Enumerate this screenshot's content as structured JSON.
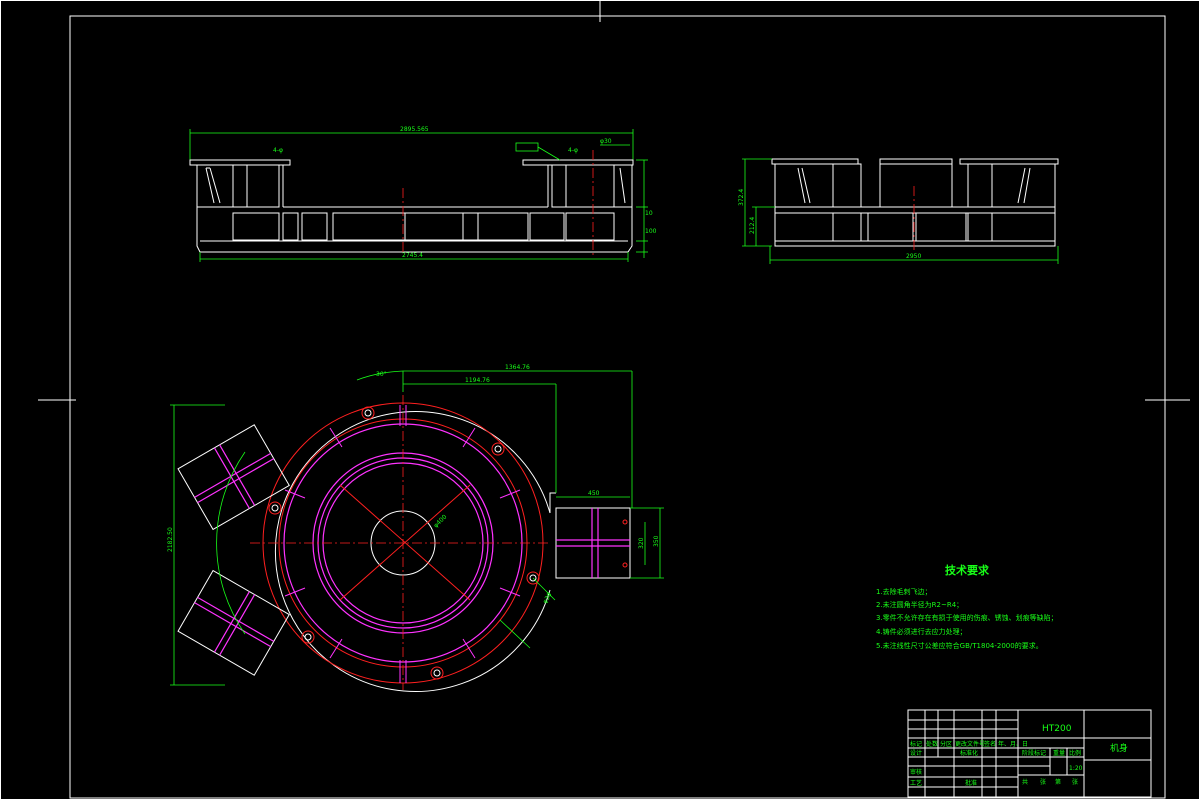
{
  "drawing": {
    "dims": {
      "top_length": "2895.565",
      "base_length": "2745.4",
      "side_width": "2950",
      "dim_a": "40",
      "dim_b": "4-φ",
      "dim_c": "4-φ",
      "dim_d": "40",
      "side_h1": "212.4",
      "side_h2": "372.4",
      "angle": "30°",
      "r1": "1194.76",
      "r2": "1364.76",
      "span": "2182.50",
      "bore": "φ400",
      "arm_len": "450",
      "arm_w": "350",
      "arm_w2": "320",
      "hole": "φ30",
      "v1": "10",
      "v2": "1",
      "v3": "100"
    },
    "tech_title": "技术要求",
    "tech_items": [
      "1.去除毛刺飞边；",
      "2.未注圆角半径为R2~R4；",
      "3.零件不允许存在有损于使用的伤痕、锈蚀、划痕等缺陷；",
      "4.铸件必须进行去应力处理；",
      "5.未注线性尺寸公差应符合GB/T1804-2000的要求。"
    ],
    "title_block": {
      "material": "HT200",
      "part_name": "机身",
      "labels": [
        "标记",
        "处数",
        "分区",
        "更改文件号",
        "签名",
        "年、月、日"
      ],
      "row2": [
        "设计",
        "标准化",
        "阶段标记",
        "重量",
        "比例"
      ],
      "row3": [
        "审核",
        "工艺",
        "批准",
        "共",
        "张",
        "第",
        "张"
      ],
      "scale": "1:20"
    }
  }
}
